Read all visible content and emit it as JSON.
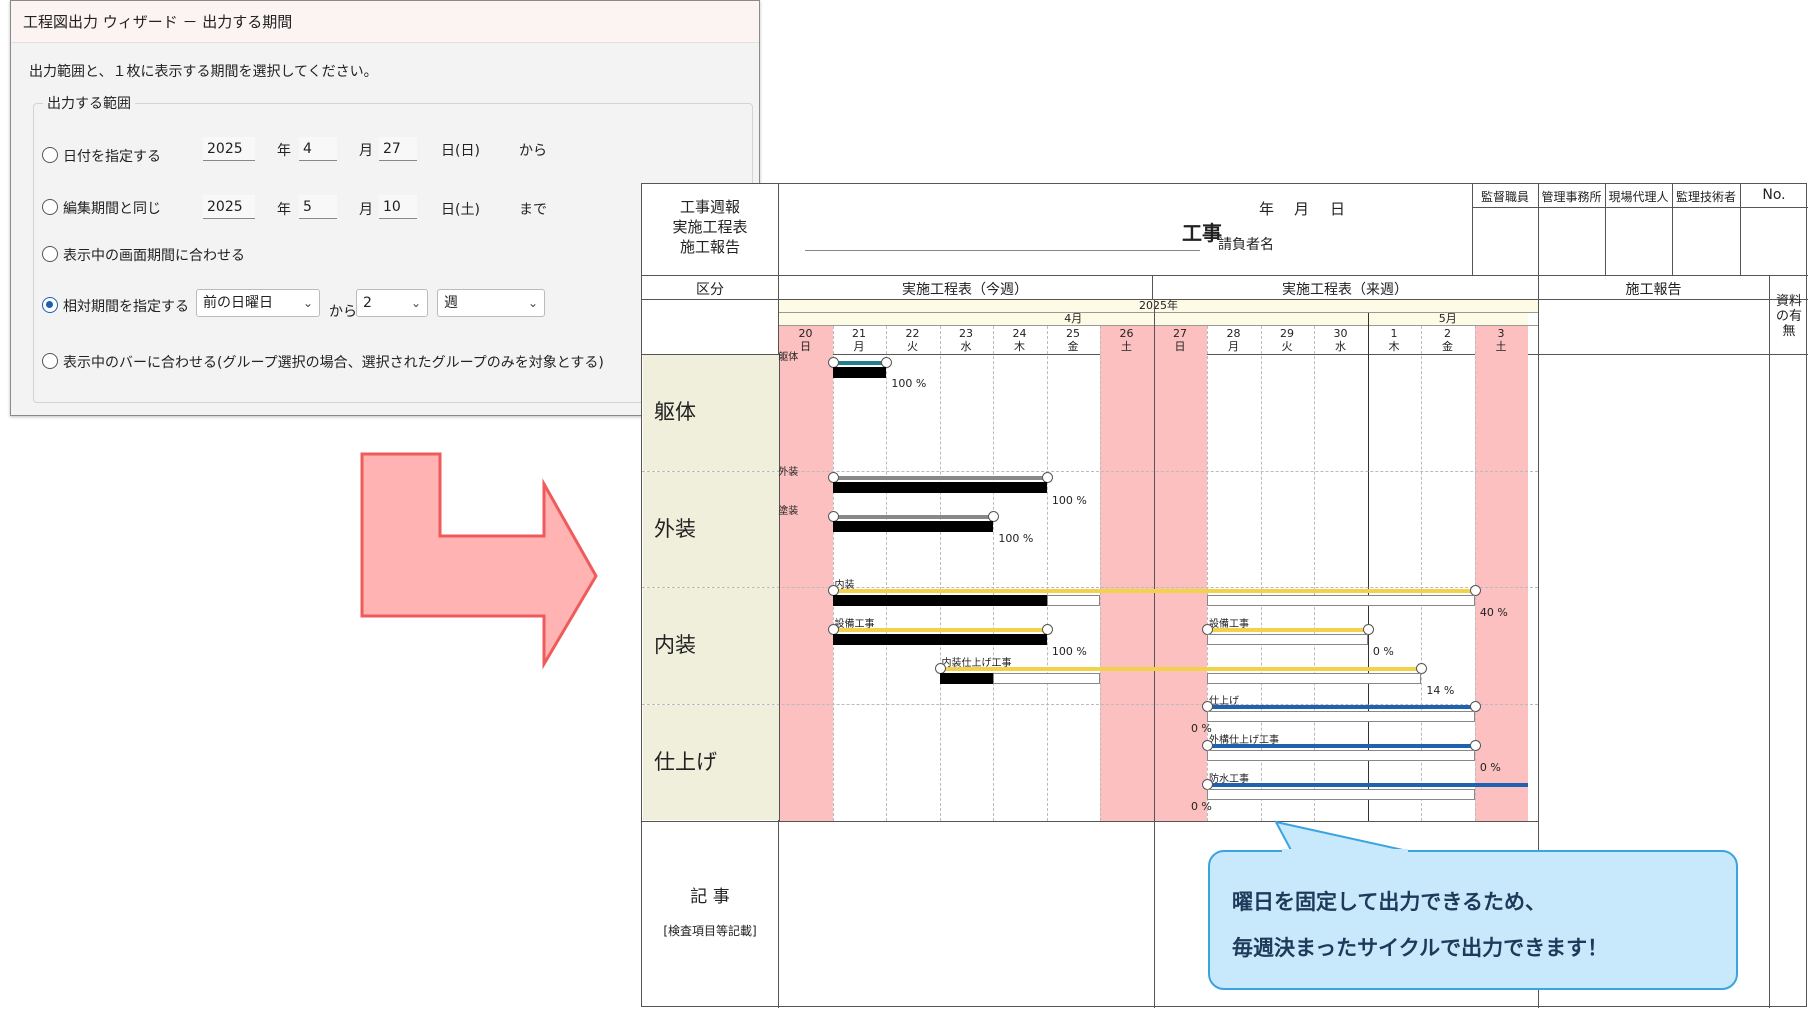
{
  "dialog": {
    "title": "工程図出力 ウィザード － 出力する期間",
    "instruction": "出力範囲と、１枚に表示する期間を選択してください。",
    "group_label": "出力する範囲",
    "option1": {
      "label": "日付を指定する",
      "year": "2025",
      "year_unit": "年",
      "month": "4",
      "month_unit": "月",
      "day": "27",
      "day_unit": "日(日)",
      "suffix": "から"
    },
    "option2": {
      "label": "編集期間と同じ",
      "year": "2025",
      "year_unit": "年",
      "month": "5",
      "month_unit": "月",
      "day": "10",
      "day_unit": "日(土)",
      "suffix": "まで"
    },
    "option3": {
      "label": "表示中の画面期間に合わせる"
    },
    "option4": {
      "label": "相対期間を指定する",
      "base_value": "前の日曜日",
      "from_label": "から",
      "count_value": "2",
      "unit_value": "週",
      "selected": true
    },
    "option5": {
      "label": "表示中のバーに合わせる(グループ選択の場合、選択されたグループのみを対象とする)"
    }
  },
  "report": {
    "title_lines": [
      "工事週報",
      "実施工程表",
      "施工報告"
    ],
    "date_labels": [
      "年",
      "月",
      "日"
    ],
    "project_suffix": "工事",
    "contractor_label": "請負者名",
    "stamp_headers": [
      "監督職員",
      "管理事務所",
      "現場代理人",
      "監理技術者",
      "No."
    ],
    "section_headers": {
      "category": "区分",
      "this_week": "実施工程表（今週）",
      "next_week": "実施工程表（来週）",
      "report": "施工報告",
      "materials": "資料の有無"
    },
    "calendar": {
      "year": "2025年",
      "month1": "4月",
      "month2": "5月",
      "days": [
        {
          "d": "20",
          "w": "日"
        },
        {
          "d": "21",
          "w": "月"
        },
        {
          "d": "22",
          "w": "火"
        },
        {
          "d": "23",
          "w": "水"
        },
        {
          "d": "24",
          "w": "木"
        },
        {
          "d": "25",
          "w": "金"
        },
        {
          "d": "26",
          "w": "土"
        },
        {
          "d": "27",
          "w": "日"
        },
        {
          "d": "28",
          "w": "月"
        },
        {
          "d": "29",
          "w": "火"
        },
        {
          "d": "30",
          "w": "水"
        },
        {
          "d": "1",
          "w": "木"
        },
        {
          "d": "2",
          "w": "金"
        },
        {
          "d": "3",
          "w": "土"
        }
      ]
    },
    "categories": [
      "躯体",
      "外装",
      "内装",
      "仕上げ"
    ],
    "tasks": [
      {
        "name": "躯体",
        "pct": "100 %"
      },
      {
        "name": "外装",
        "pct": "100 %"
      },
      {
        "name": "塗装",
        "pct": "100 %"
      },
      {
        "name": "内装",
        "pct": "40 %"
      },
      {
        "name": "設備工事",
        "pct": "100 %"
      },
      {
        "name": "設備工事",
        "pct": "0 %"
      },
      {
        "name": "内装仕上げ工事",
        "pct": "14 %"
      },
      {
        "name": "仕上げ",
        "pct": "0 %"
      },
      {
        "name": "外構仕上げ工事",
        "pct": "0 %"
      },
      {
        "name": "防水工事",
        "pct": "0 %"
      }
    ],
    "notes_label": "記 事",
    "notes_sub": "[検査項目等記載]"
  },
  "callout": {
    "line1": "曜日を固定して出力できるため、",
    "line2": "毎週決まったサイクルで出力できます！"
  },
  "colors": {
    "holiday": "#fcc0c0",
    "category_bg": "#efefdc",
    "callout_bg": "#c8e9fb",
    "callout_border": "#3aa3e0",
    "arrow_fill": "#ffb3b3",
    "arrow_stroke": "#ef5b5b",
    "plan_teal": "#1f7f8a",
    "plan_gray": "#888888",
    "plan_yellow": "#f2d24a",
    "plan_blue": "#1f63b0"
  }
}
